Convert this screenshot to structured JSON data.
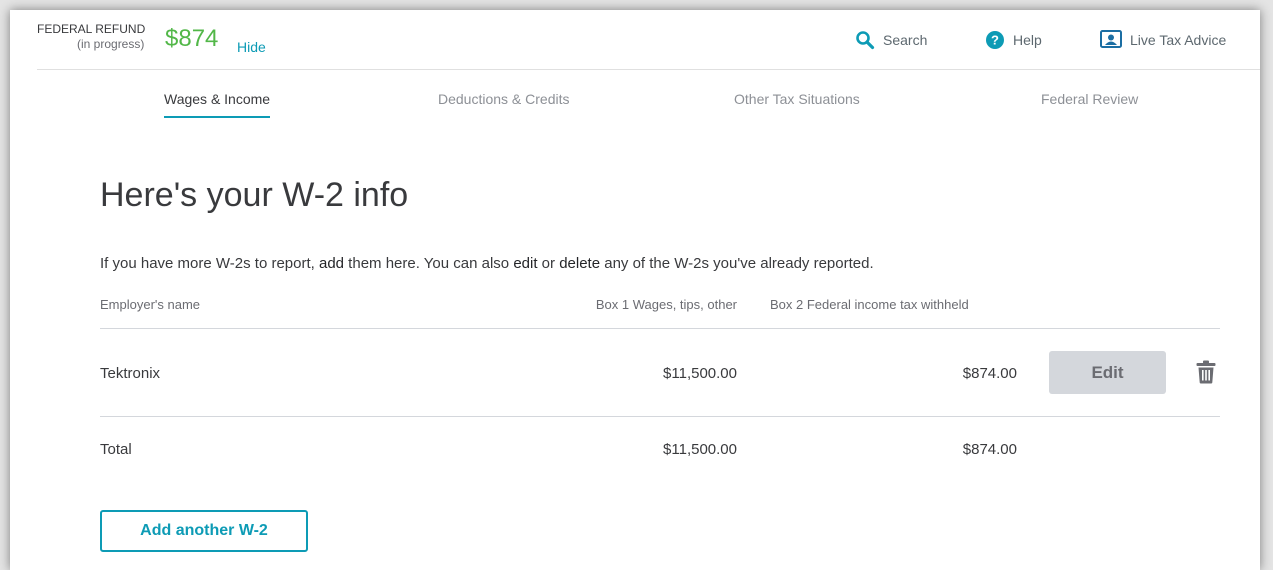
{
  "header": {
    "refund_label_line1": "FEDERAL REFUND",
    "refund_label_line2": "(in progress)",
    "refund_amount": "$874",
    "hide_label": "Hide",
    "search_label": "Search",
    "help_label": "Help",
    "advice_label": "Live Tax Advice",
    "icons": {
      "search": "search-icon",
      "help": "help-icon",
      "advice": "live-advisor-icon"
    }
  },
  "tabs": [
    {
      "label": "Wages & Income",
      "active": true
    },
    {
      "label": "Deductions & Credits",
      "active": false
    },
    {
      "label": "Other Tax Situations",
      "active": false
    },
    {
      "label": "Federal Review",
      "active": false
    }
  ],
  "main": {
    "title": "Here's your W-2 info",
    "intro": {
      "part1": "If you have more W-2s to report, ",
      "add": "add",
      "part2": " them here. You can also ",
      "edit": "edit",
      "part3": " or ",
      "delete": "delete",
      "part4": " any of the W-2s you've already reported."
    },
    "table": {
      "headers": [
        "Employer's name",
        "Box 1 Wages, tips, other",
        "Box 2 Federal income tax withheld"
      ],
      "rows": [
        {
          "employer": "Tektronix",
          "box1": "$11,500.00",
          "box2": "$874.00",
          "edit_label": "Edit",
          "delete_icon": "trash-icon"
        }
      ],
      "total": {
        "label": "Total",
        "box1": "$11,500.00",
        "box2": "$874.00"
      }
    },
    "add_button": "Add another W-2"
  },
  "colors": {
    "accent": "#0d9bb5",
    "refund_green": "#52b748",
    "edit_button_bg": "#d4d7dc"
  }
}
